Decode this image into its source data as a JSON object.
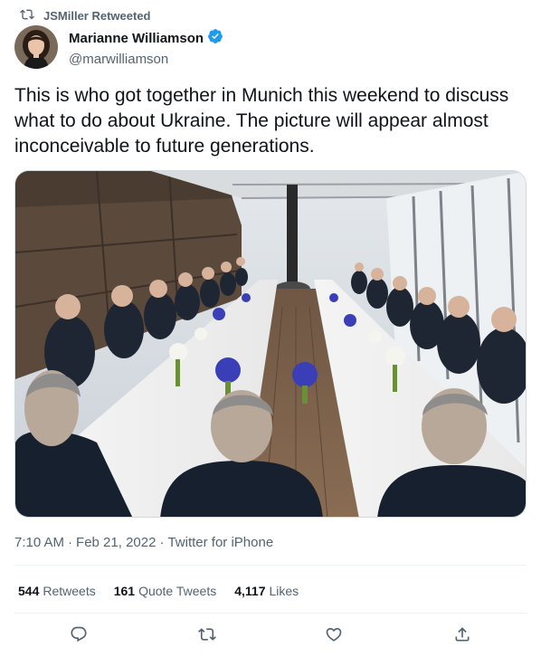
{
  "retweet_context": {
    "label": "JSMiller Retweeted",
    "icon": "retweet-icon"
  },
  "author": {
    "display_name": "Marianne Williamson",
    "handle": "@marwilliamson",
    "verified": true,
    "verified_color": "#1d9bf0"
  },
  "tweet": {
    "text": "This is who got together in Munich this weekend to discuss what to do about Ukraine. The picture will appear almost inconceivable to future generations."
  },
  "meta": {
    "time": "7:10 AM",
    "separator1": "·",
    "date": "Feb 21, 2022",
    "separator2": "·",
    "source": "Twitter for iPhone"
  },
  "stats": {
    "retweets_count": "544",
    "retweets_label": "Retweets",
    "quotes_count": "161",
    "quotes_label": "Quote Tweets",
    "likes_count": "4,117",
    "likes_label": "Likes"
  },
  "actions": [
    {
      "name": "reply",
      "icon": "reply-icon"
    },
    {
      "name": "retweet",
      "icon": "retweet-icon"
    },
    {
      "name": "like",
      "icon": "heart-icon"
    },
    {
      "name": "share",
      "icon": "share-icon"
    }
  ],
  "colors": {
    "text_primary": "#0f1419",
    "text_secondary": "#536471",
    "divider": "#eff3f4",
    "accent": "#1d9bf0"
  }
}
